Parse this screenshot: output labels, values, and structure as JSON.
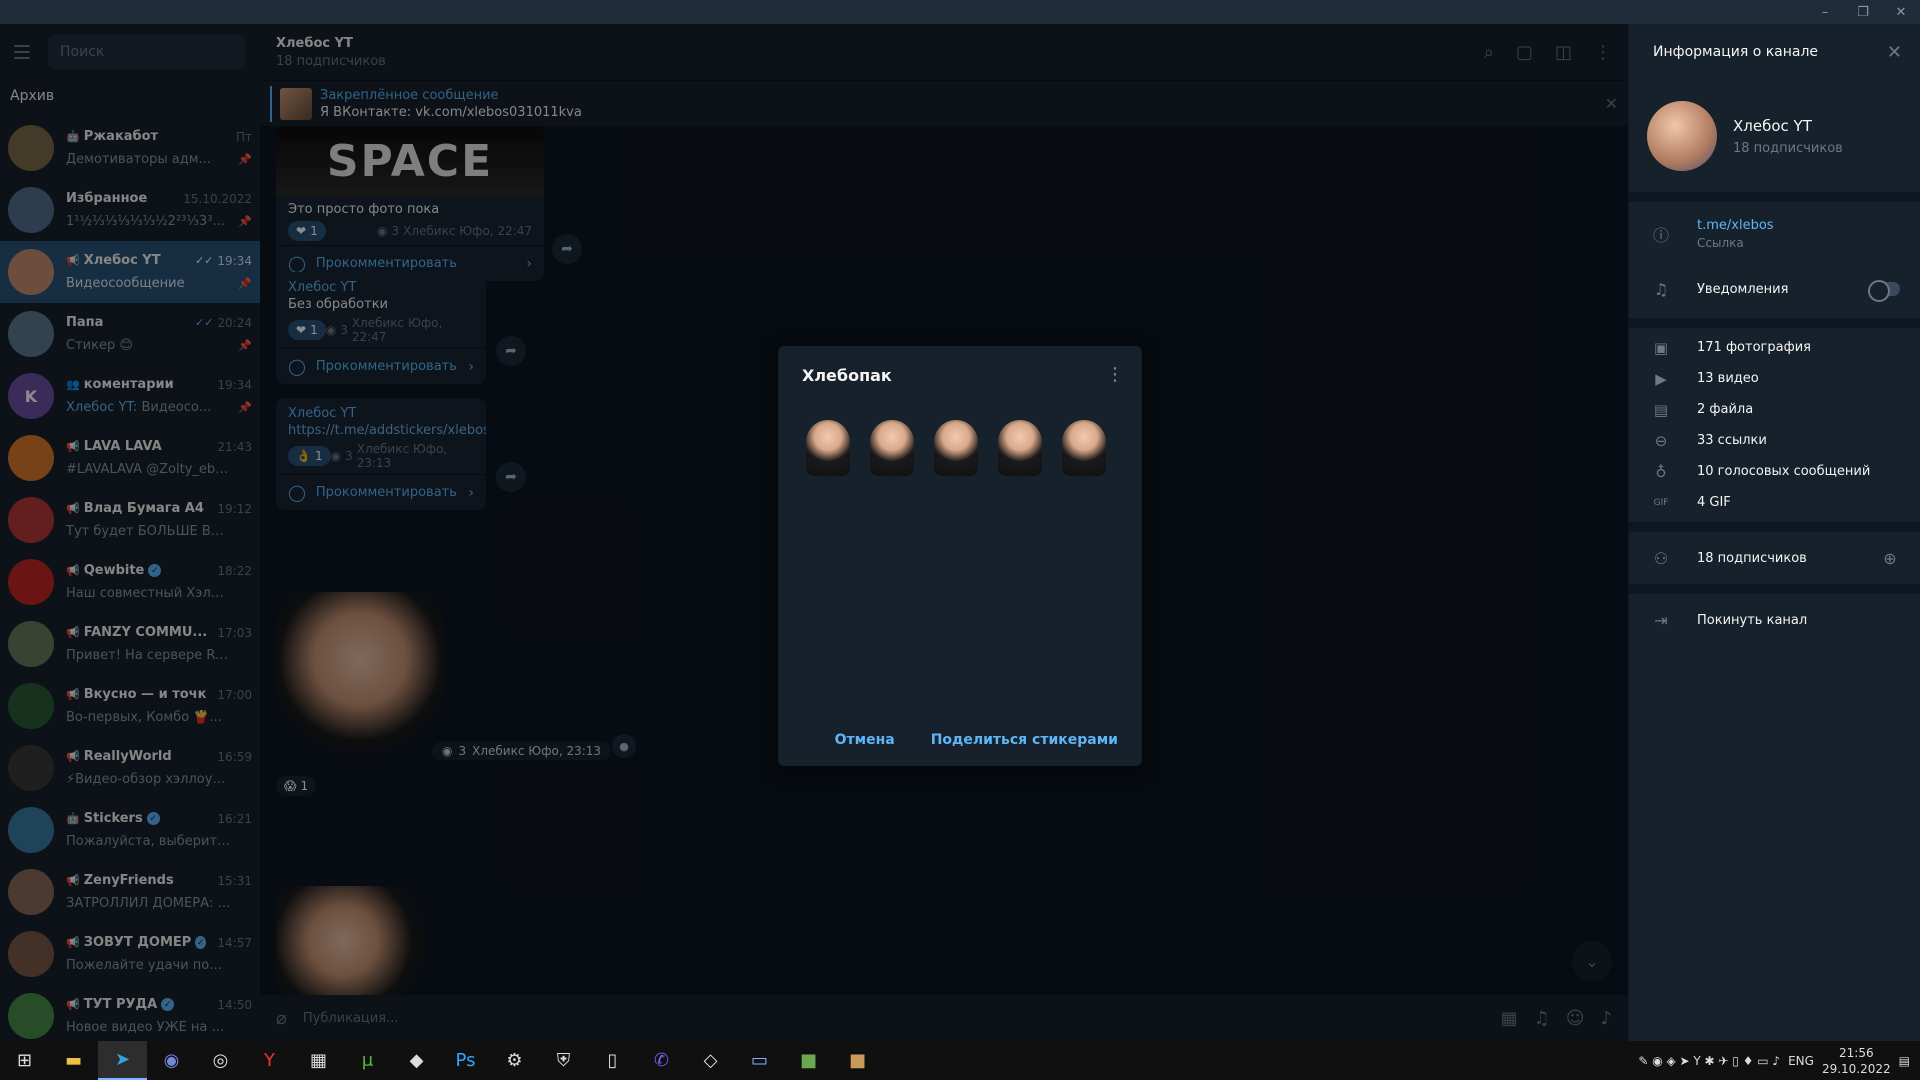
{
  "window": {
    "minimize": "–",
    "restore": "❐",
    "close": "✕"
  },
  "sidebar": {
    "search_placeholder": "Поиск",
    "archive_label": "Архив",
    "chats": [
      {
        "name": "Ржакабот",
        "icon": "bot",
        "time": "Пт",
        "preview": "Демотиваторы адм...",
        "verified": false,
        "pinned": true,
        "avatar_color": "#7a6a4a"
      },
      {
        "name": "Избранное",
        "icon": "",
        "time": "15.10.2022",
        "preview": "1¹½⅓⅓⅓⅓⅓½2²³⅓3³...",
        "verified": false,
        "pinned": true,
        "avatar_color": "#4f6f8f"
      },
      {
        "name": "Хлебос YT",
        "icon": "channel",
        "time": "19:34",
        "preview": "Видеосообщение",
        "verified": false,
        "pinned": true,
        "active": true,
        "ticks": "✓✓",
        "avatar_color": "#c48f6e"
      },
      {
        "name": "Папа",
        "icon": "",
        "time": "20:24",
        "preview": "Стикер 😊",
        "verified": false,
        "pinned": true,
        "ticks": "✓✓",
        "avatar_color": "#5a7a8f"
      },
      {
        "name": "коментарии",
        "icon": "group",
        "time": "19:34",
        "preview_prefix": "Хлебос YT:",
        "preview": " Видеосо...",
        "verified": false,
        "pinned": true,
        "avatar_letter": "K",
        "avatar_color": "#6b4fa6"
      },
      {
        "name": "LAVA LAVA",
        "icon": "channel",
        "time": "21:43",
        "preview": "#LAVALAVA @Zolty_ebal...",
        "verified": false,
        "pinned": false,
        "avatar_color": "#d9782a"
      },
      {
        "name": "Влад Бумага А4",
        "icon": "channel",
        "time": "19:12",
        "preview": "Тут будет БОЛЬШЕ ВАШИХ ...",
        "verified": true,
        "pinned": false,
        "avatar_color": "#b53a3a"
      },
      {
        "name": "Qewbite",
        "icon": "channel",
        "time": "18:22",
        "preview": "Наш совместный Хэлло...",
        "verified": true,
        "pinned": false,
        "avatar_color": "#c42525"
      },
      {
        "name": "FANZY COMMU...",
        "icon": "channel",
        "time": "17:03",
        "preview": "Привет! На сервере ReallyW...",
        "verified": true,
        "pinned": false,
        "avatar_color": "#6a7a5a"
      },
      {
        "name": "Вкусно — и точка",
        "icon": "channel",
        "time": "17:00",
        "preview": "Во-первых, Комбо 🍟...",
        "verified": false,
        "pinned": false,
        "avatar_color": "#2a5a3a"
      },
      {
        "name": "ReallyWorld",
        "icon": "channel",
        "time": "16:59",
        "preview": "⚡Видео-обзор хэллоуинс...",
        "verified": false,
        "pinned": false,
        "avatar_color": "#3a3a3a"
      },
      {
        "name": "Stickers",
        "icon": "bot",
        "time": "16:21",
        "preview": "Пожалуйста, выберите назв...",
        "verified": true,
        "pinned": false,
        "avatar_color": "#3a7aa0"
      },
      {
        "name": "ZenyFriends",
        "icon": "channel",
        "time": "15:31",
        "preview": "ЗАТРОЛЛИЛ ДОМЕРА: https...",
        "verified": false,
        "pinned": false,
        "avatar_color": "#8a6a5a"
      },
      {
        "name": "ЗОВУТ ДОМЕР",
        "icon": "channel",
        "time": "14:57",
        "preview": "Пожелайте удачи пожалуйс...",
        "verified": true,
        "pinned": false,
        "avatar_color": "#7a5a4a"
      },
      {
        "name": "ТУТ РУДА",
        "icon": "channel",
        "time": "14:50",
        "preview": "Новое видео УЖЕ на КАНАЛ...",
        "verified": true,
        "pinned": false,
        "avatar_color": "#4a8a4a"
      }
    ]
  },
  "chat": {
    "title": "Хлебос YT",
    "subtitle": "18 подписчиков",
    "pinned_title": "Закреплённое сообщение",
    "pinned_text": "Я ВКонтакте: vk.com/xlebos031011kva",
    "photo_caption": "SPACE",
    "messages": [
      {
        "text": "Это просто фото пока",
        "reaction": "1",
        "views": "3",
        "meta": "Хлебикс Юфо, 22:47",
        "comment": "Прокомментировать"
      },
      {
        "author": "Хлебос YT",
        "text": "Без обработки",
        "reaction": "1",
        "views": "3",
        "meta": "Хлебикс Юфо, 22:47",
        "comment": "Прокомментировать"
      },
      {
        "author": "Хлебос YT",
        "link": "https://t.me/addstickers/xlebos",
        "reaction": "1",
        "views": "3",
        "meta": "Хлебикс Юфо, 23:13",
        "comment": "Прокомментировать"
      }
    ],
    "video_views": "3",
    "video_meta": "Хлебикс Юфо, 23:13",
    "video_reaction": "1",
    "composer_placeholder": "Публикация..."
  },
  "info": {
    "header": "Информация о канале",
    "name": "Хлебос YT",
    "subscribers": "18 подписчиков",
    "link": "t.me/xlebos",
    "link_label": "Ссылка",
    "notifications": "Уведомления",
    "media": [
      {
        "icon": "photo-icon",
        "glyph": "▣",
        "label": "171 фотография"
      },
      {
        "icon": "video-icon",
        "glyph": "▶",
        "label": "13 видео"
      },
      {
        "icon": "file-icon",
        "glyph": "▤",
        "label": "2 файла"
      },
      {
        "icon": "link-icon",
        "glyph": "⊖",
        "label": "33 ссылки"
      },
      {
        "icon": "mic-icon",
        "glyph": "♁",
        "label": "10 голосовых сообщений"
      },
      {
        "icon": "gif-icon",
        "glyph": "GIF",
        "label": "4 GIF"
      }
    ],
    "members": "18 подписчиков",
    "leave": "Покинуть канал"
  },
  "dialog": {
    "title": "Хлебопак",
    "cancel": "Отмена",
    "share": "Поделиться стикерами",
    "sticker_count": 5
  },
  "taskbar": {
    "lang": "ENG",
    "time": "21:56",
    "date": "29.10.2022"
  }
}
